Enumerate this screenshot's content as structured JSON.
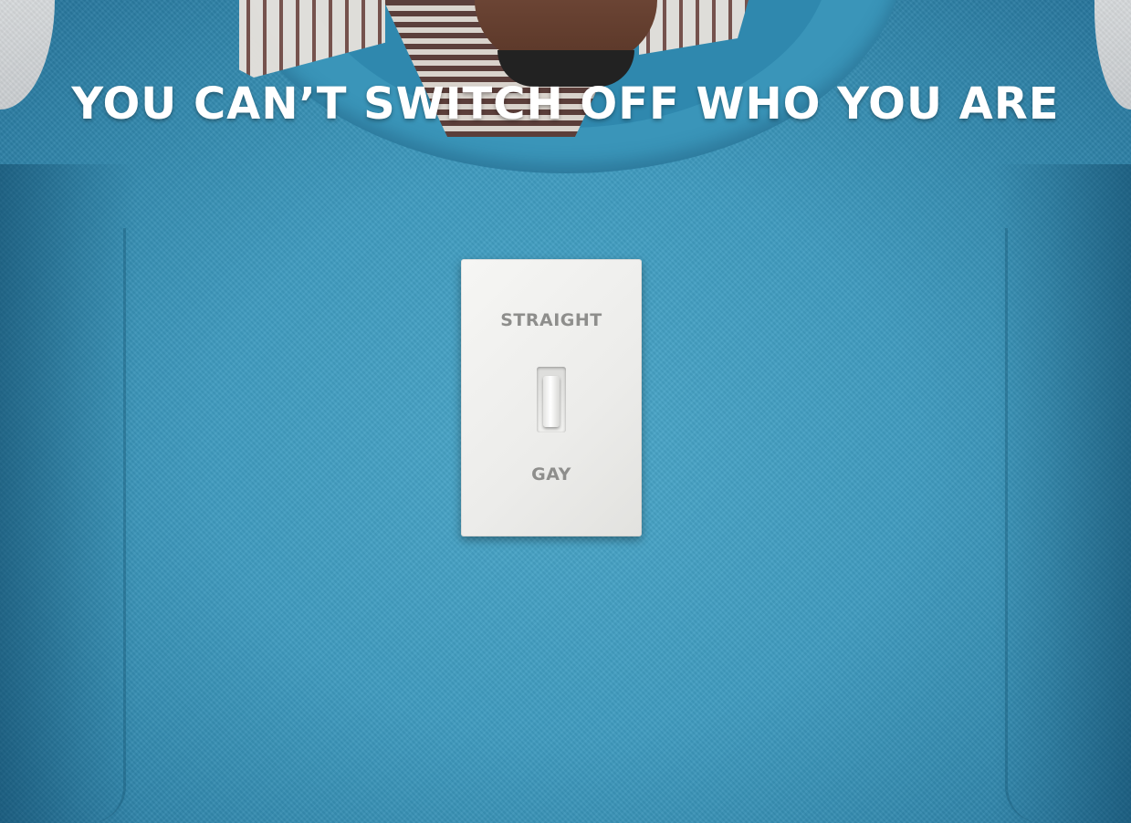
{
  "poster": {
    "headline": "YOU CAN’T SWITCH OFF WHO YOU ARE"
  },
  "light_switch": {
    "top_label": "STRAIGHT",
    "bottom_label": "GAY",
    "lever_position": "down"
  },
  "colors": {
    "sweater": "#3f9bbf",
    "headline_text": "#ffffff",
    "switch_plate": "#f0f0ee",
    "switch_label": "#8e8e8c"
  }
}
